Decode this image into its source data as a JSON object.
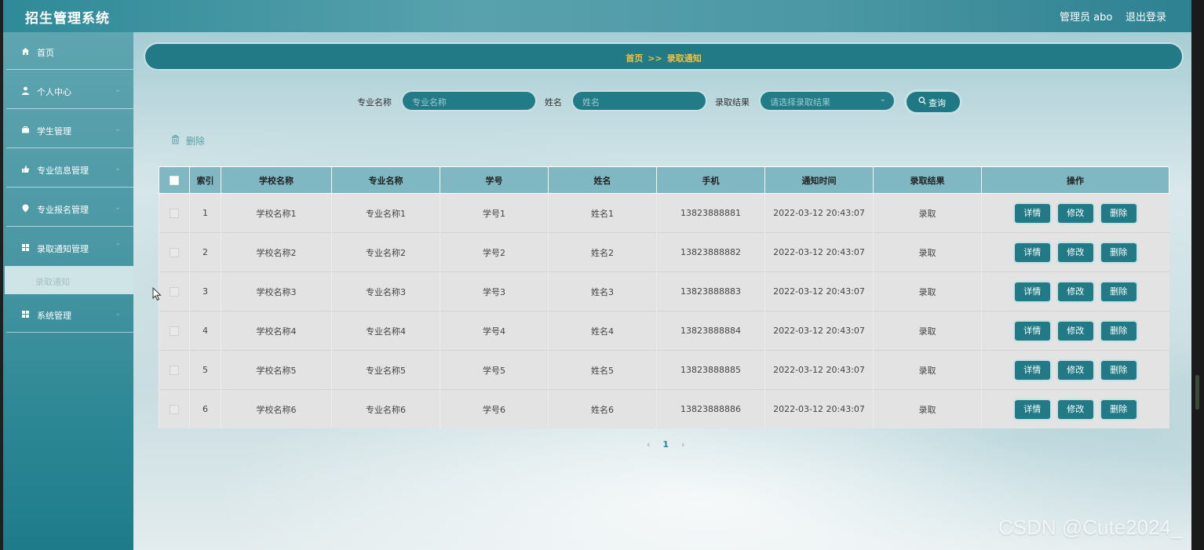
{
  "app": {
    "title": "招生管理系统",
    "user": "管理员 abo",
    "logout": "退出登录"
  },
  "sidebar": {
    "items": [
      {
        "label": "首页",
        "icon": "home-icon"
      },
      {
        "label": "个人中心",
        "icon": "user-icon"
      },
      {
        "label": "学生管理",
        "icon": "briefcase-icon"
      },
      {
        "label": "专业信息管理",
        "icon": "thumbs-up-icon"
      },
      {
        "label": "专业报名管理",
        "icon": "location-pin-icon"
      },
      {
        "label": "录取通知管理",
        "icon": "grid-icon"
      },
      {
        "label": "系统管理",
        "icon": "grid-icon"
      }
    ],
    "submenu": {
      "label": "录取通知"
    }
  },
  "breadcrumb": {
    "home": "首页",
    "separator": ">>",
    "current": "录取通知"
  },
  "search": {
    "major_label": "专业名称",
    "major_placeholder": "专业名称",
    "name_label": "姓名",
    "name_placeholder": "姓名",
    "result_label": "录取结果",
    "result_placeholder": "请选择录取结果",
    "button": "查询"
  },
  "actions": {
    "bulk_delete": "删除"
  },
  "table": {
    "columns": [
      "索引",
      "学校名称",
      "专业名称",
      "学号",
      "姓名",
      "手机",
      "通知时间",
      "录取结果",
      "操作"
    ],
    "rows": [
      {
        "index": "1",
        "school": "学校名称1",
        "major": "专业名称1",
        "sid": "学号1",
        "name": "姓名1",
        "phone": "13823888881",
        "time": "2022-03-12 20:43:07",
        "result": "录取"
      },
      {
        "index": "2",
        "school": "学校名称2",
        "major": "专业名称2",
        "sid": "学号2",
        "name": "姓名2",
        "phone": "13823888882",
        "time": "2022-03-12 20:43:07",
        "result": "录取"
      },
      {
        "index": "3",
        "school": "学校名称3",
        "major": "专业名称3",
        "sid": "学号3",
        "name": "姓名3",
        "phone": "13823888883",
        "time": "2022-03-12 20:43:07",
        "result": "录取"
      },
      {
        "index": "4",
        "school": "学校名称4",
        "major": "专业名称4",
        "sid": "学号4",
        "name": "姓名4",
        "phone": "13823888884",
        "time": "2022-03-12 20:43:07",
        "result": "录取"
      },
      {
        "index": "5",
        "school": "学校名称5",
        "major": "专业名称5",
        "sid": "学号5",
        "name": "姓名5",
        "phone": "13823888885",
        "time": "2022-03-12 20:43:07",
        "result": "录取"
      },
      {
        "index": "6",
        "school": "学校名称6",
        "major": "专业名称6",
        "sid": "学号6",
        "name": "姓名6",
        "phone": "13823888886",
        "time": "2022-03-12 20:43:07",
        "result": "录取"
      }
    ],
    "row_buttons": {
      "detail": "详情",
      "edit": "修改",
      "delete": "删除"
    }
  },
  "pagination": {
    "prev": "‹",
    "current": "1",
    "next": "›"
  },
  "watermark": "CSDN @Cute2024_",
  "colors": {
    "primary": "#237a87",
    "accent": "#f0c23a",
    "header_bg": "#7fb7c3"
  }
}
